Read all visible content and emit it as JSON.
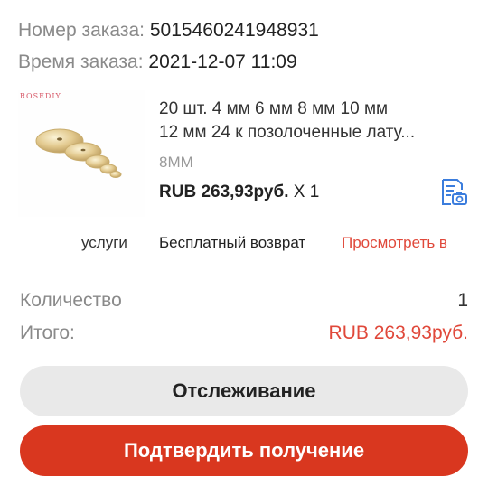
{
  "order": {
    "number_label": "Номер заказа:",
    "number_value": "5015460241948931",
    "time_label": "Время заказа:",
    "time_value": "2021-12-07 11:09"
  },
  "product": {
    "brand_mark": "ROSEDIY",
    "title_line1": "20 шт. 4 мм 6 мм 8 мм 10 мм",
    "title_line2": "12 мм 24 к позолоченные лату...",
    "variant": "8MM",
    "price": "RUB 263,93руб.",
    "quantity": "X 1",
    "photo_icon": "document-camera-icon",
    "accent_color": "#3b7ddd"
  },
  "service": {
    "label": "услуги",
    "text": "Бесплатный возврат",
    "link": "Просмотреть в"
  },
  "summary": {
    "qty_label": "Количество",
    "qty_value": "1",
    "total_label": "Итого:",
    "total_value": "RUB 263,93руб."
  },
  "actions": {
    "track_label": "Отслеживание",
    "confirm_label": "Подтвердить получение",
    "confirm_color": "#d9371f"
  }
}
